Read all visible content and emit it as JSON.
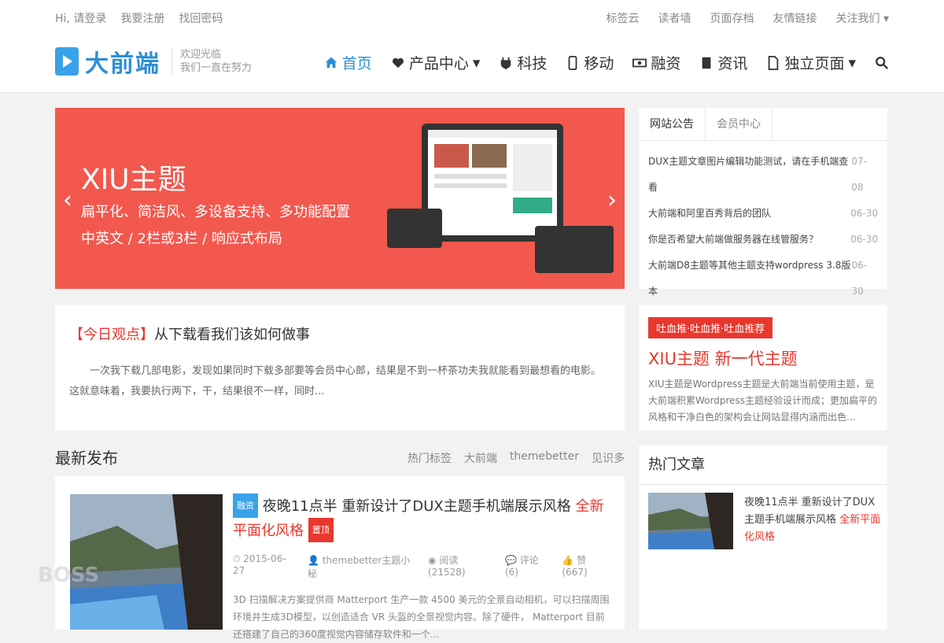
{
  "topbar": {
    "login": "Hi, 请登录",
    "register": "我要注册",
    "forgot": "找回密码",
    "right": [
      "标签云",
      "读者墙",
      "页面存档",
      "友情链接",
      "关注我们"
    ]
  },
  "logo": {
    "name": "大前端",
    "slogan1": "欢迎光临",
    "slogan2": "我们一直在努力"
  },
  "nav": [
    "首页",
    "产品中心",
    "科技",
    "移动",
    "融资",
    "资讯",
    "独立页面"
  ],
  "slider": {
    "title": "XIU主题",
    "sub1": "扁平化、简洁风、多设备支持、多功能配置",
    "sub2": "中英文 / 2栏或3栏 / 响应式布局",
    "bg": "#f2584e"
  },
  "notice": {
    "tabs": [
      "网站公告",
      "会员中心"
    ],
    "items": [
      {
        "title": "DUX主题文章图片编辑功能测试，请在手机端查看",
        "date": "07-08"
      },
      {
        "title": "大前端和阿里百秀背后的团队",
        "date": "06-30"
      },
      {
        "title": "你是否希望大前端做服务器在线管服务？",
        "date": "06-30"
      },
      {
        "title": "大前端D8主题等其他主题支持wordpress 3.8版本",
        "date": "06-30"
      }
    ]
  },
  "today": {
    "tag": "【今日观点】",
    "title": "从下载看我们该如何做事",
    "excerpt": "一次我下载几部电影，发现如果同时下载多部要等会员中心郎，结果是不到一杯茶功夫我就能看到最想看的电影。这就意味着，我要执行两下，干，结果很不一样，同时..."
  },
  "promo": {
    "button": "吐血推·吐血推·吐血推荐",
    "title": "XIU主题 新一代主题",
    "text": "XIU主题是Wordpress主题是大前端当前使用主题，是大前端积累Wordpress主题经验设计而成；更加扁平的风格和干净白色的架构会让网站显得内涵而出色..."
  },
  "latest": {
    "heading": "最新发布",
    "tags": [
      "热门标签",
      "大前端",
      "themebetter",
      "见识多"
    ],
    "post": {
      "cat": "融资",
      "title": "夜晚11点半 重新设计了DUX主题手机端展示风格",
      "highlight": "全新平面化风格",
      "hot": "置顶",
      "date": "2015-06-27",
      "author": "themebetter主题小秘",
      "views": "阅读(21528)",
      "comments": "评论(6)",
      "likes": "赞(667)",
      "excerpt": "3D 扫描解决方案提供商 Matterport 生产一款 4500 美元的全景自动相机，可以扫描周围环境并生成3D模型，以创造适合 VR 头盔的全景视觉内容。除了硬件， Matterport 目前还搭建了自己的360度视觉内容储存软件和一个..."
    }
  },
  "hot": {
    "heading": "热门文章",
    "item_title": "夜晚11点半 重新设计了DUX主题手机端展示风格",
    "item_hl": "全新平面化风格"
  },
  "watermark": "BOSS"
}
